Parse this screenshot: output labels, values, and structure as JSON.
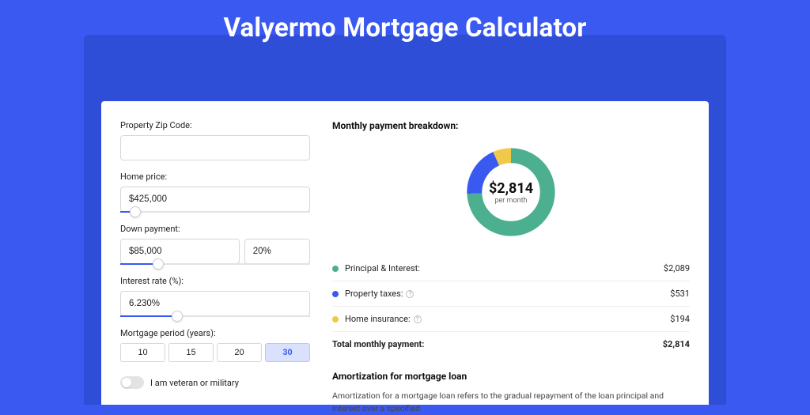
{
  "title": "Valyermo Mortgage Calculator",
  "form": {
    "zip": {
      "label": "Property Zip Code:",
      "value": ""
    },
    "home_price": {
      "label": "Home price:",
      "value": "$425,000",
      "slider_pct": 8
    },
    "down_payment": {
      "label": "Down payment:",
      "amount": "$85,000",
      "percent": "20%",
      "slider_pct": 20
    },
    "interest_rate": {
      "label": "Interest rate (%):",
      "value": "6.230%",
      "slider_pct": 30
    },
    "period": {
      "label": "Mortgage period (years):",
      "options": [
        "10",
        "15",
        "20",
        "30"
      ],
      "selected": 3
    },
    "veteran": {
      "label": "I am veteran or military",
      "checked": false
    }
  },
  "breakdown": {
    "title": "Monthly payment breakdown:",
    "center_amount": "$2,814",
    "center_sub": "per month",
    "items": [
      {
        "label": "Principal & Interest:",
        "value": "$2,089",
        "color": "#4caf8f",
        "info": false
      },
      {
        "label": "Property taxes:",
        "value": "$531",
        "color": "#3a59f0",
        "info": true
      },
      {
        "label": "Home insurance:",
        "value": "$194",
        "color": "#f0c94a",
        "info": true
      }
    ],
    "total_label": "Total monthly payment:",
    "total_value": "$2,814"
  },
  "amortization": {
    "title": "Amortization for mortgage loan",
    "text": "Amortization for a mortgage loan refers to the gradual repayment of the loan principal and interest over a specified"
  },
  "chart_data": {
    "type": "pie",
    "title": "Monthly payment breakdown",
    "series": [
      {
        "name": "Principal & Interest",
        "value": 2089,
        "color": "#4caf8f"
      },
      {
        "name": "Property taxes",
        "value": 531,
        "color": "#3a59f0"
      },
      {
        "name": "Home insurance",
        "value": 194,
        "color": "#f0c94a"
      }
    ],
    "total": 2814,
    "center_label": "$2,814 per month"
  }
}
